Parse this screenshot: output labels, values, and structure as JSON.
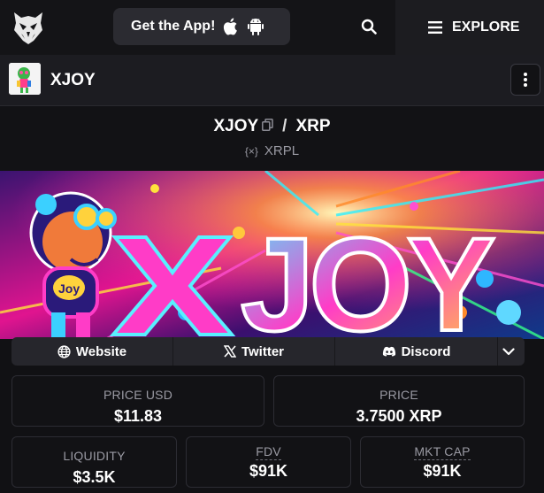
{
  "nav": {
    "get_app_label": "Get the App!",
    "explore_label": "EXPLORE",
    "icons": [
      "owl-logo-icon",
      "apple-icon",
      "android-icon",
      "search-icon",
      "hamburger-icon"
    ]
  },
  "token": {
    "name": "XJOY",
    "base": "XJOY",
    "separator": "/",
    "quote": "XRP",
    "chain": "XRPL",
    "chain_icon": "{×}"
  },
  "banner": {
    "text": "JOY",
    "x_letter": "X",
    "badge": "Joy"
  },
  "socials": [
    {
      "label": "Website",
      "icon": "globe-icon"
    },
    {
      "label": "Twitter",
      "icon": "x-logo-icon"
    },
    {
      "label": "Discord",
      "icon": "discord-icon"
    }
  ],
  "stats": {
    "price_usd": {
      "label": "PRICE USD",
      "value": "$11.83"
    },
    "price": {
      "label": "PRICE",
      "value": "3.7500 XRP"
    },
    "liquidity": {
      "label": "LIQUIDITY",
      "value": "$3.5K"
    },
    "fdv": {
      "label": "FDV",
      "value": "$91K"
    },
    "mkt_cap": {
      "label": "MKT CAP",
      "value": "$91K"
    }
  },
  "colors": {
    "background": "#121215",
    "topbar": "#141417",
    "button_dark": "#2b2b31",
    "banner_pink": "#ff2fb4",
    "banner_blue": "#1fd2ff"
  }
}
